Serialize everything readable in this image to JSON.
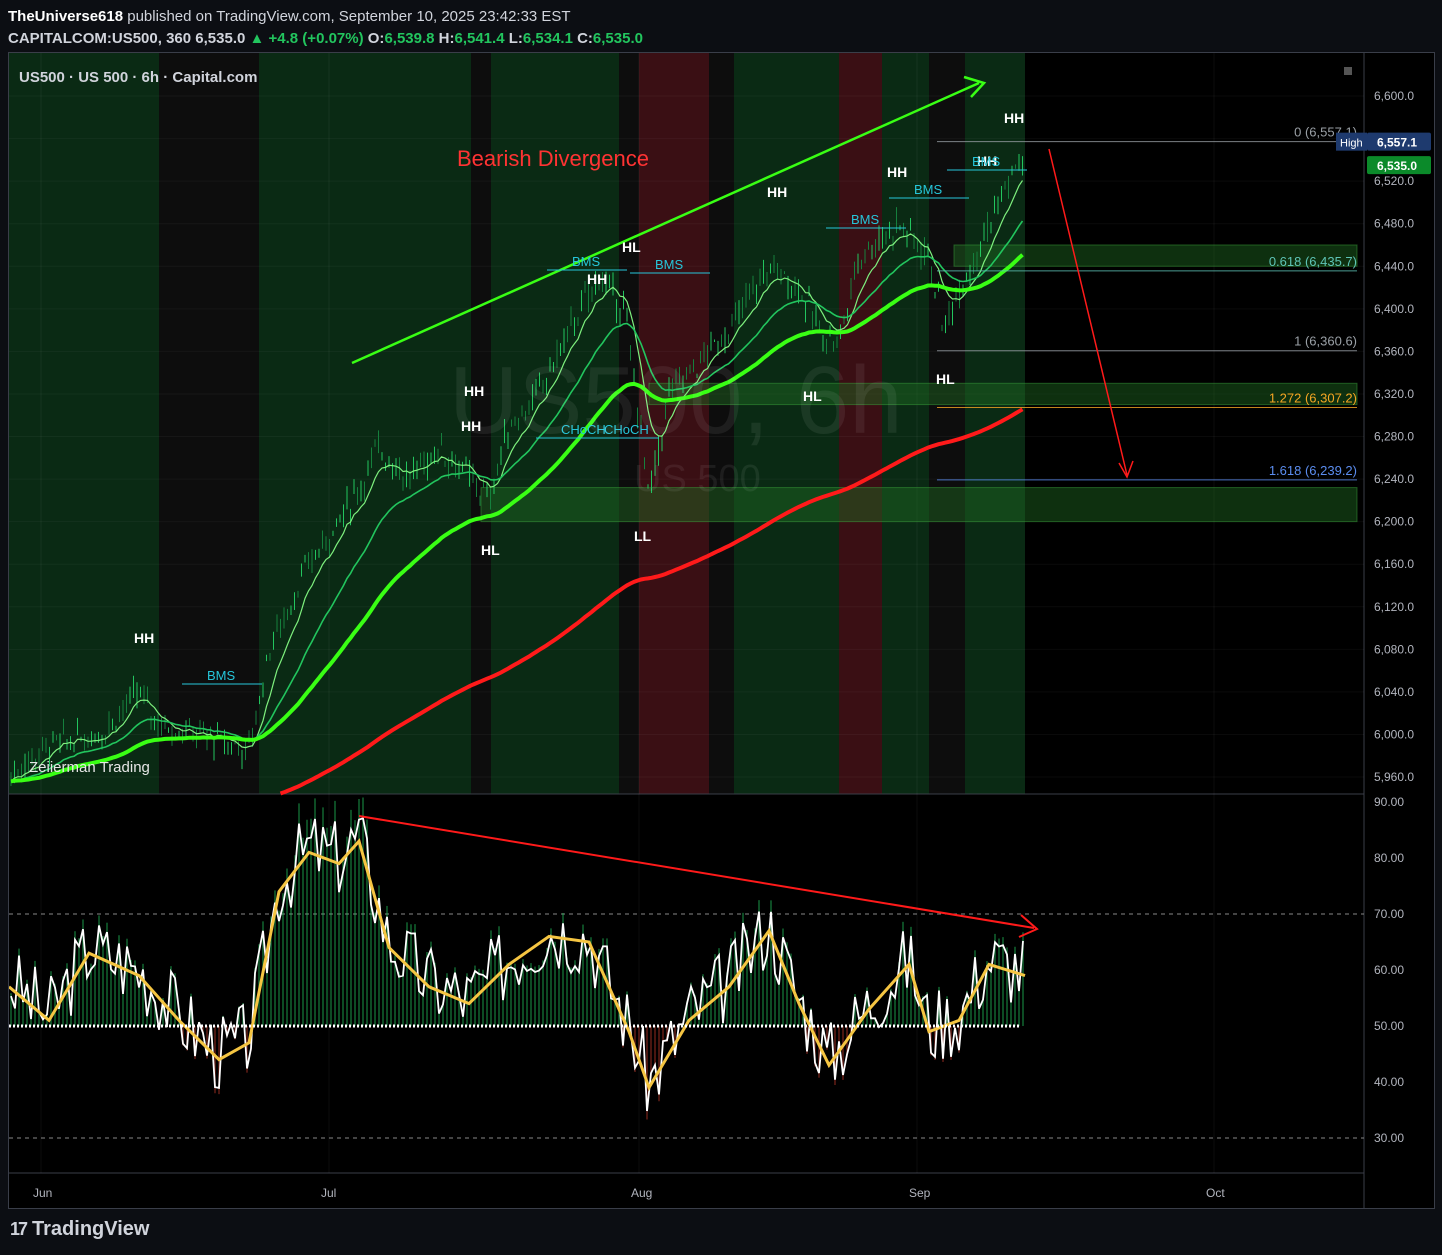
{
  "header": {
    "author": "TheUniverse618",
    "published_text": "published on TradingView.com, September 10, 2025 23:42:33 EST",
    "symbol": "CAPITALCOM:US500, 360",
    "price": "6,535.0",
    "change": "+4.8 (+0.07%)",
    "ohlc": {
      "O": "6,539.8",
      "H": "6,541.4",
      "L": "6,534.1",
      "C": "6,535.0"
    }
  },
  "legend": "US500 · US 500 · 6h · Capital.com",
  "watermark": {
    "line1": "US500, 6h",
    "line2": "US 500"
  },
  "signature": "Zeiierman Trading",
  "footer": {
    "brand": "TradingView"
  },
  "colors": {
    "up": "#22c55e",
    "bright_green": "#39ff14",
    "red": "#ff1a1a",
    "bms": "#26c6da",
    "fib_blue": "#5b8def",
    "fib_orange": "#f5a623",
    "osc_yellow": "#f5c542"
  },
  "chart_data": [
    {
      "type": "line",
      "title": "Bearish Divergence",
      "ylim": [
        5940,
        6620
      ],
      "y_ticks": [
        "6,600.0",
        "6,560.0",
        "6,520.0",
        "6,480.0",
        "6,440.0",
        "6,400.0",
        "6,360.0",
        "6,320.0",
        "6,280.0",
        "6,240.0",
        "6,200.0",
        "6,160.0",
        "6,120.0",
        "6,080.0",
        "6,040.0",
        "6,000.0",
        "5,960.0"
      ],
      "x_ticks": [
        "Jun",
        "Jul",
        "Aug",
        "Sep",
        "Oct"
      ],
      "price_tags": [
        {
          "label": "High",
          "value": "6,557.1"
        },
        {
          "value": "6,535.0"
        }
      ],
      "fib_levels": [
        {
          "label": "0 (6,557.1)",
          "value": 6557.1
        },
        {
          "label": "0.618 (6,435.7)",
          "value": 6435.7
        },
        {
          "label": "1 (6,360.6)",
          "value": 6360.6
        },
        {
          "label": "1.272 (6,307.2)",
          "value": 6307.2
        },
        {
          "label": "1.618 (6,239.2)",
          "value": 6239.2
        }
      ],
      "annotations": [
        "HH",
        "BMS",
        "HH",
        "BMS",
        "HL",
        "HH",
        "HH",
        "BMS",
        "CHoCH",
        "HL",
        "CHoCH",
        "LL",
        "HH",
        "HL",
        "BMS",
        "HH",
        "BMS",
        "HH",
        "BMS",
        "HL",
        "HH"
      ]
    },
    {
      "type": "line",
      "ylim": [
        25,
        90
      ],
      "y_ticks": [
        "90.00",
        "80.00",
        "70.00",
        "60.00",
        "50.00",
        "40.00",
        "30.00"
      ]
    }
  ]
}
